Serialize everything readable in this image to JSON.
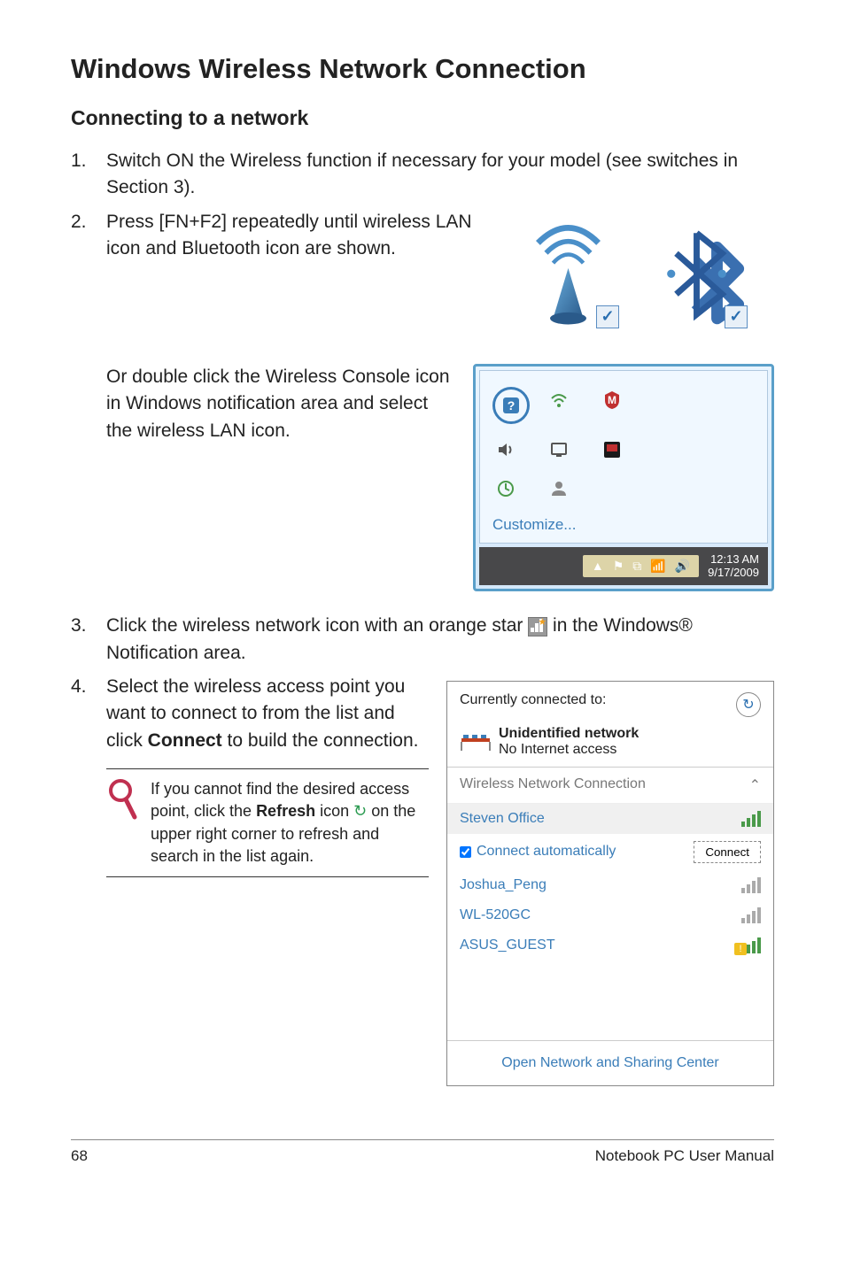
{
  "title": "Windows Wireless Network Connection",
  "subtitle": "Connecting to a network",
  "steps": {
    "s1num": "1.",
    "s1": "Switch ON the Wireless function if necessary for your model (see switches in Section 3).",
    "s2num": "2.",
    "s2": "Press [FN+F2] repeatedly until wireless LAN icon and Bluetooth icon are shown.",
    "s2b": "Or double click the Wireless Console icon in Windows notification area and select the wireless LAN icon.",
    "s3num": "3.",
    "s3a": "Click the wireless network icon with an orange star ",
    "s3b": " in the Windows® Notification area.",
    "s4num": "4.",
    "s4a": "Select the wireless access point you want to connect to from the list and click ",
    "s4bold": "Connect",
    "s4b": " to build the connection."
  },
  "note": {
    "a": "If you cannot find the desired access point, click the ",
    "bold": "Refresh",
    "b": " icon ",
    "c": " on the upper right corner to refresh and search in the list again."
  },
  "tray": {
    "customize": "Customize...",
    "time": "12:13 AM",
    "date": "9/17/2009"
  },
  "network_panel": {
    "connected_label": "Currently connected to:",
    "network_name": "Unidentified network",
    "access": "No Internet access",
    "section": "Wireless Network Connection",
    "expand": "⌃",
    "items": [
      "Steven Office",
      "Joshua_Peng",
      "WL-520GC",
      "ASUS_GUEST"
    ],
    "auto_connect": "Connect automatically",
    "connect_btn": "Connect",
    "footer": "Open Network and Sharing Center"
  },
  "footer": {
    "page": "68",
    "label": "Notebook PC User Manual"
  }
}
